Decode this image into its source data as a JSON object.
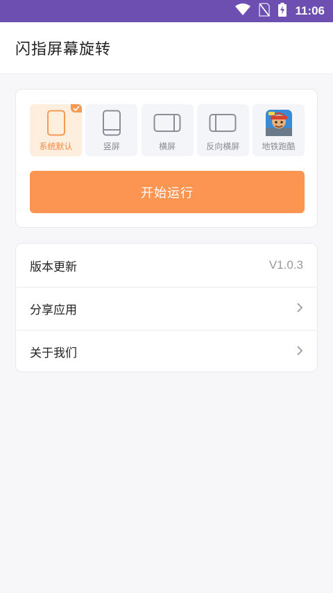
{
  "status_bar": {
    "time": "11:06",
    "background": "#6c4fb1",
    "icons": [
      "wifi-icon",
      "no-sim-icon",
      "battery-charging-icon"
    ]
  },
  "app_bar": {
    "title": "闪指屏幕旋转"
  },
  "modes": [
    {
      "label": "系统默认",
      "icon": "phone-outline-icon",
      "selected": true
    },
    {
      "label": "竖屏",
      "icon": "portrait-phone-icon",
      "selected": false
    },
    {
      "label": "横屏",
      "icon": "landscape-phone-icon",
      "selected": false
    },
    {
      "label": "反向横屏",
      "icon": "reverse-landscape-phone-icon",
      "selected": false
    },
    {
      "label": "地铁跑酷",
      "icon": "subway-surfers-game-icon",
      "selected": false
    }
  ],
  "start_button": {
    "label": "开始运行",
    "color": "#fd9552"
  },
  "settings": [
    {
      "label": "版本更新",
      "value": "V1.0.3"
    },
    {
      "label": "分享应用",
      "icon": "chevron-right-icon"
    },
    {
      "label": "关于我们",
      "icon": "chevron-right-icon"
    }
  ],
  "colors": {
    "accent": "#f39a55",
    "page_bg": "#f7f7fa"
  }
}
